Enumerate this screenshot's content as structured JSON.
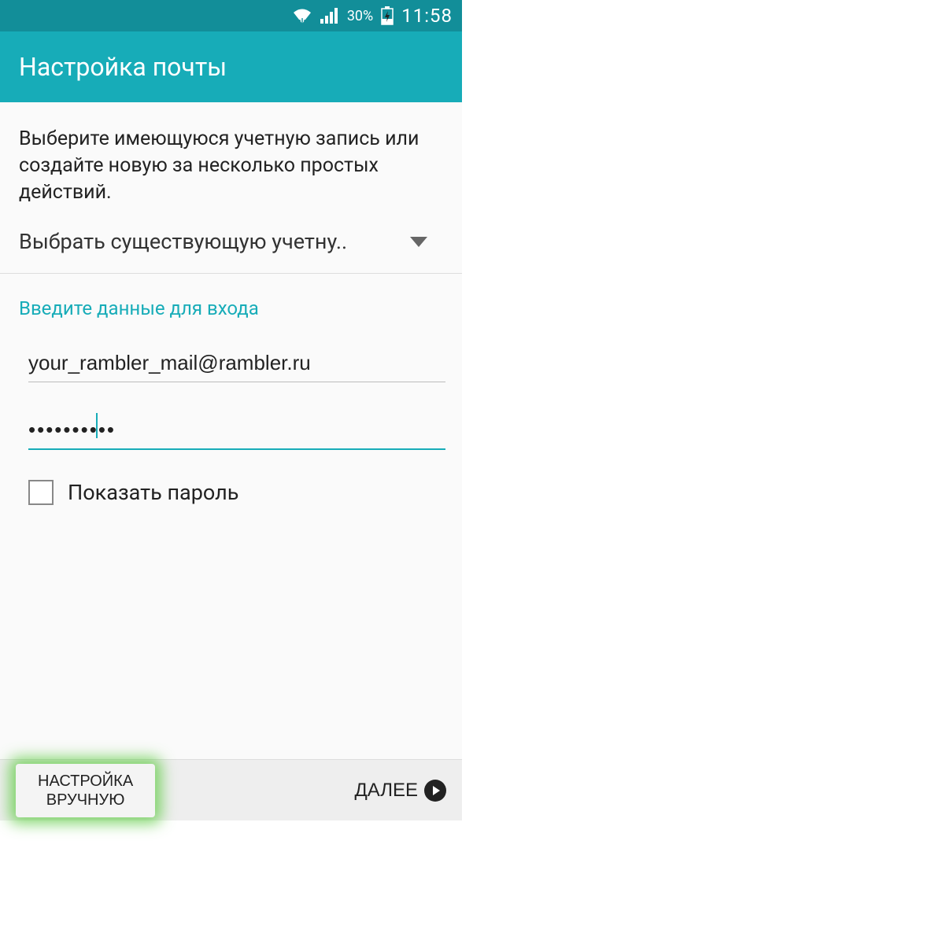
{
  "status_bar": {
    "battery_pct": "30%",
    "time": "11:58"
  },
  "app_bar": {
    "title": "Настройка почты"
  },
  "intro": {
    "text": "Выберите имеющуюся учетную запись или создайте новую за несколько простых действий."
  },
  "account_selector": {
    "label": "Выбрать существующую учетну.."
  },
  "login": {
    "section_label": "Введите данные для входа",
    "email_value": "your_rambler_mail@rambler.ru",
    "password_value": "••••••••••",
    "show_password_label": "Показать пароль"
  },
  "buttons": {
    "manual_line1": "НАСТРОЙКА",
    "manual_line2": "ВРУЧНУЮ",
    "next": "ДАЛЕЕ"
  }
}
